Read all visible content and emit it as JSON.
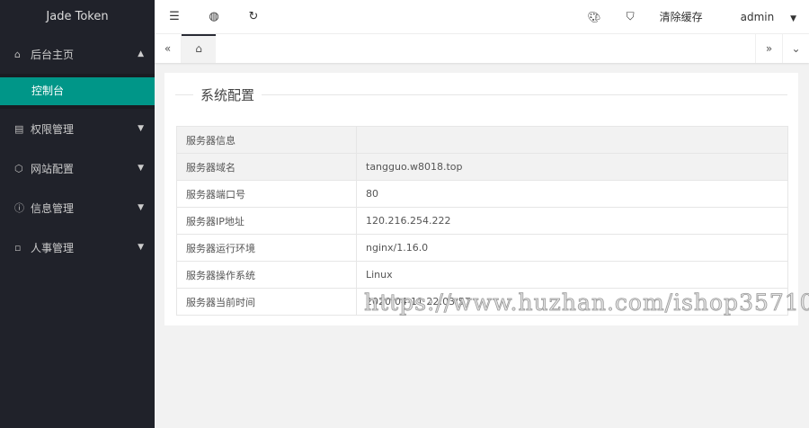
{
  "app": {
    "title": "Jade Token"
  },
  "sidebar": {
    "items": [
      {
        "label": "后台主页",
        "icon": "home-icon",
        "expanded": true,
        "children": [
          {
            "label": "控制台",
            "active": true
          }
        ]
      },
      {
        "label": "权限管理",
        "icon": "list-icon"
      },
      {
        "label": "网站配置",
        "icon": "cube-icon"
      },
      {
        "label": "信息管理",
        "icon": "info-icon"
      },
      {
        "label": "人事管理",
        "icon": "file-icon"
      }
    ]
  },
  "header": {
    "clear_cache": "清除缓存",
    "user": "admin"
  },
  "section": {
    "title": "系统配置"
  },
  "table": {
    "header": [
      "服务器信息",
      ""
    ],
    "rows": [
      [
        "服务器域名",
        "tangguo.w8018.top"
      ],
      [
        "服务器端口号",
        "80"
      ],
      [
        "服务器IP地址",
        "120.216.254.222"
      ],
      [
        "服务器运行环境",
        "nginx/1.16.0"
      ],
      [
        "服务器操作系统",
        "Linux"
      ],
      [
        "服务器当前时间",
        "2020-04-11 22:03:57"
      ]
    ]
  },
  "watermark": "https://www.huzhan.com/ishop35710"
}
